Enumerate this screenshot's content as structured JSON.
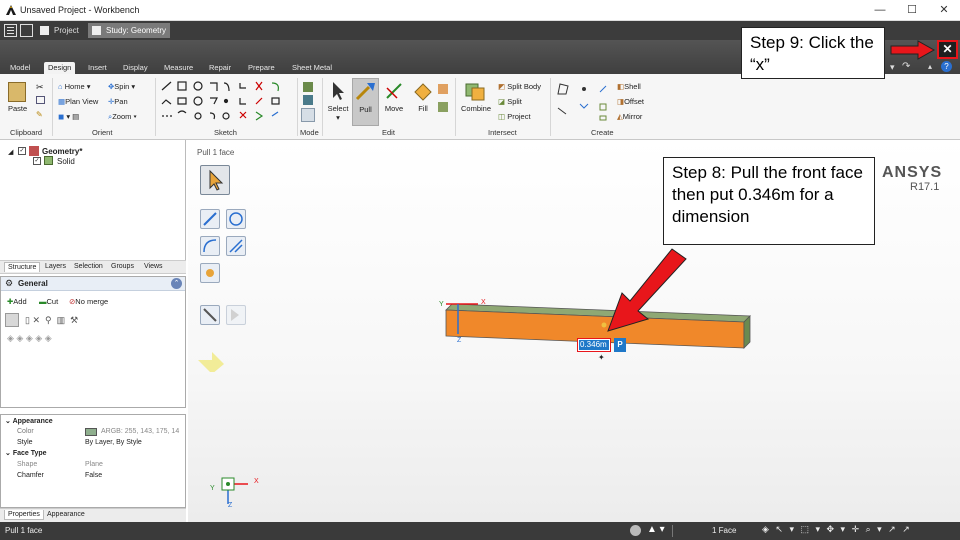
{
  "window": {
    "title": "Unsaved Project - Workbench",
    "minimize": "—",
    "maximize": "☐",
    "close": "✕"
  },
  "workbench": {
    "project_tab": "Project",
    "study_tab": "Study: Geometry"
  },
  "ribbon_tabs": [
    "Model",
    "Design",
    "Insert",
    "Display",
    "Measure",
    "Repair",
    "Prepare",
    "Sheet Metal"
  ],
  "ribbon": {
    "clipboard": {
      "paste": "Paste",
      "label": "Clipboard"
    },
    "orient": {
      "home": "Home",
      "spin": "Spin",
      "plan_view": "Plan View",
      "pan": "Pan",
      "zoom": "Zoom",
      "label": "Orient"
    },
    "sketch": {
      "label": "Sketch"
    },
    "mode": {
      "label": "Mode"
    },
    "edit": {
      "select": "Select",
      "pull": "Pull",
      "move": "Move",
      "fill": "Fill",
      "label": "Edit"
    },
    "intersect": {
      "combine": "Combine",
      "split_body": "Split Body",
      "split": "Split",
      "project": "Project",
      "label": "Intersect"
    },
    "create": {
      "shell": "Shell",
      "offset": "Offset",
      "mirror": "Mirror",
      "label": "Create"
    }
  },
  "tree": {
    "geometry": "Geometry*",
    "solid": "Solid"
  },
  "panel_tabs": [
    "Structure",
    "Layers",
    "Selection",
    "Groups",
    "Views"
  ],
  "options": {
    "header": "General",
    "add": "Add",
    "cut": "Cut",
    "no_merge": "No merge"
  },
  "properties": {
    "appearance_header": "Appearance",
    "color_label": "Color",
    "color_value": "ARGB: 255, 143, 175, 14",
    "style_label": "Style",
    "style_value": "By Layer, By Style",
    "face_type_header": "Face Type",
    "shape_label": "Shape",
    "shape_value": "Plane",
    "chamfer_label": "Chamfer",
    "chamfer_value": "False"
  },
  "bottom_tabs": [
    "Properties",
    "Appearance"
  ],
  "viewport": {
    "tool_hint": "Pull 1 face",
    "ansys_brand": "ANSYS",
    "ansys_version": "R17.1",
    "dimension_value": "0.346m",
    "dimension_p": "P",
    "axis_y": "Y",
    "axis_z": "Z",
    "axis_x": "X",
    "triad_y": "Y",
    "triad_z": "Z",
    "triad_x": "X"
  },
  "callouts": {
    "step9": "Step 9: Click the “x”",
    "step8": "Step 8: Pull the front face then put 0.346m for a dimension"
  },
  "status": {
    "left": "Pull 1 face",
    "selection": "1 Face"
  },
  "colors": {
    "beam_front": "#f0882a",
    "beam_top": "#8fa874",
    "arrow": "#e8161b",
    "accent_blue": "#1f78c8"
  }
}
